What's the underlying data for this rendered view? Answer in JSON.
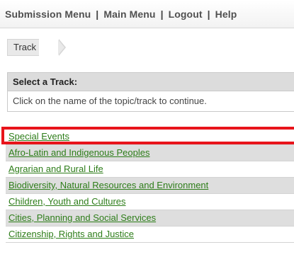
{
  "nav": {
    "submission_menu": "Submission Menu",
    "main_menu": "Main Menu",
    "logout": "Logout",
    "help": "Help",
    "separator": "|"
  },
  "breadcrumb": {
    "label": "Track"
  },
  "select_panel": {
    "title": "Select a Track:",
    "instruction": "Click on the name of the topic/track to continue."
  },
  "tracks": [
    "Special Events",
    "Afro-Latin and Indigenous Peoples",
    "Agrarian and Rural Life",
    "Biodiversity, Natural Resources and Environment",
    "Children, Youth and Cultures",
    "Cities, Planning and Social Services",
    "Citizenship, Rights and Justice"
  ],
  "colors": {
    "link": "#2d7d19",
    "highlight": "#e8141b",
    "row_shade": "#dedede"
  }
}
